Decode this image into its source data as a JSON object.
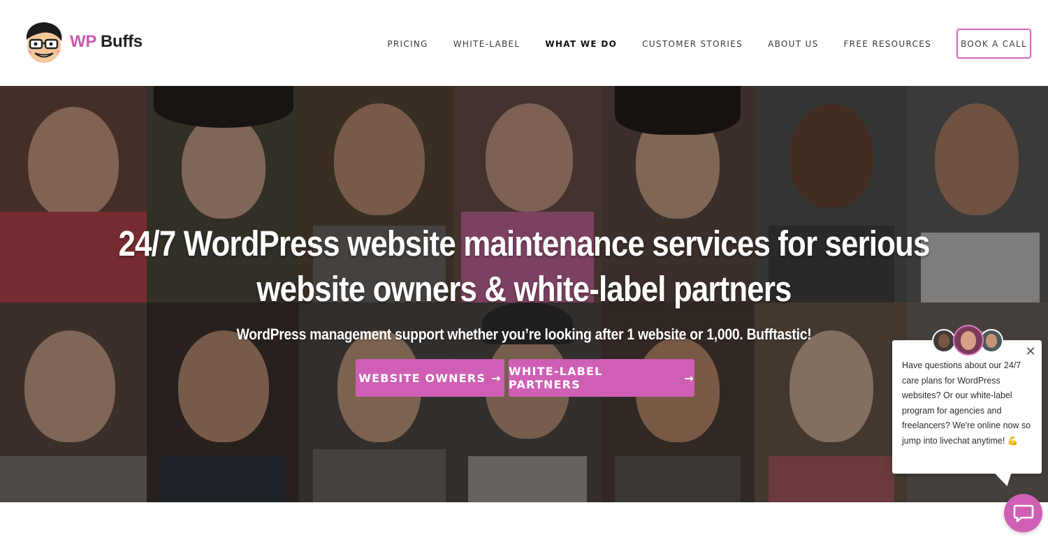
{
  "header": {
    "logo": {
      "wp": "WP",
      "buffs": "Buffs"
    },
    "nav": [
      {
        "label": "PRICING",
        "active": false
      },
      {
        "label": "WHITE-LABEL",
        "active": false
      },
      {
        "label": "WHAT WE DO",
        "active": true
      },
      {
        "label": "CUSTOMER STORIES",
        "active": false
      },
      {
        "label": "ABOUT US",
        "active": false
      },
      {
        "label": "FREE RESOURCES",
        "active": false
      }
    ],
    "cta_label": "BOOK A CALL"
  },
  "hero": {
    "title_line1": "24/7 WordPress website maintenance services for serious",
    "title_line2": "website owners & white-label partners",
    "subtitle": "WordPress management support whether you’re looking after 1 website or 1,000. Bufftastic!",
    "buttons": [
      {
        "label": "WEBSITE OWNERS",
        "arrow": "→"
      },
      {
        "label": "WHITE-LABEL PARTNERS",
        "arrow": "→"
      }
    ]
  },
  "chat": {
    "message": "Have questions about our 24/7 care plans for WordPress websites? Or our white-label program for agencies and freelancers? We're online now so jump into livechat anytime! 💪",
    "close_icon": "close-icon",
    "launcher_icon": "chat-bubble-icon"
  },
  "colors": {
    "brand_pink": "#cf5fb5",
    "nav_text": "#3a3a3a"
  }
}
